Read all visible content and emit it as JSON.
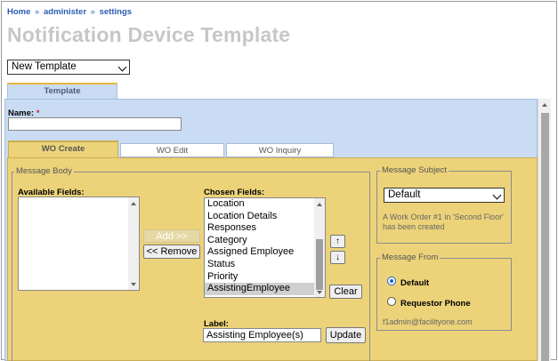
{
  "breadcrumb": {
    "home": "Home",
    "sep1": "»",
    "administer": "administer",
    "sep2": "»",
    "settings": "settings"
  },
  "page_title": "Notification Device Template",
  "template_select": {
    "value": "New Template"
  },
  "tabs": {
    "main": "Template"
  },
  "name_field": {
    "label": "Name:",
    "required_mark": "*",
    "value": ""
  },
  "subtabs": {
    "create": "WO Create",
    "edit": "WO Edit",
    "inquiry": "WO Inquiry"
  },
  "message_body": {
    "legend": "Message Body",
    "available_label": "Available Fields:",
    "chosen_label": "Chosen Fields:",
    "add_button": "Add >>",
    "remove_button": "<< Remove",
    "up_button": "↑",
    "down_button": "↓",
    "clear_button": "Clear",
    "chosen_items": [
      "Location",
      "Location Details",
      "Responses",
      "Category",
      "Assigned Employee",
      "Status",
      "Priority",
      "AssistingEmployee"
    ],
    "selected_item": "AssistingEmployee",
    "label_caption": "Label:",
    "label_value": "Assisting Employee(s)",
    "update_button": "Update"
  },
  "message_subject": {
    "legend": "Message Subject",
    "select_value": "Default",
    "preview": "A Work Order #1 in 'Second Floor' has been created"
  },
  "message_from": {
    "legend": "Message From",
    "option_default": "Default",
    "option_requestor": "Requestor Phone",
    "selected": "Default",
    "address": "f1admin@facilityone.com"
  }
}
